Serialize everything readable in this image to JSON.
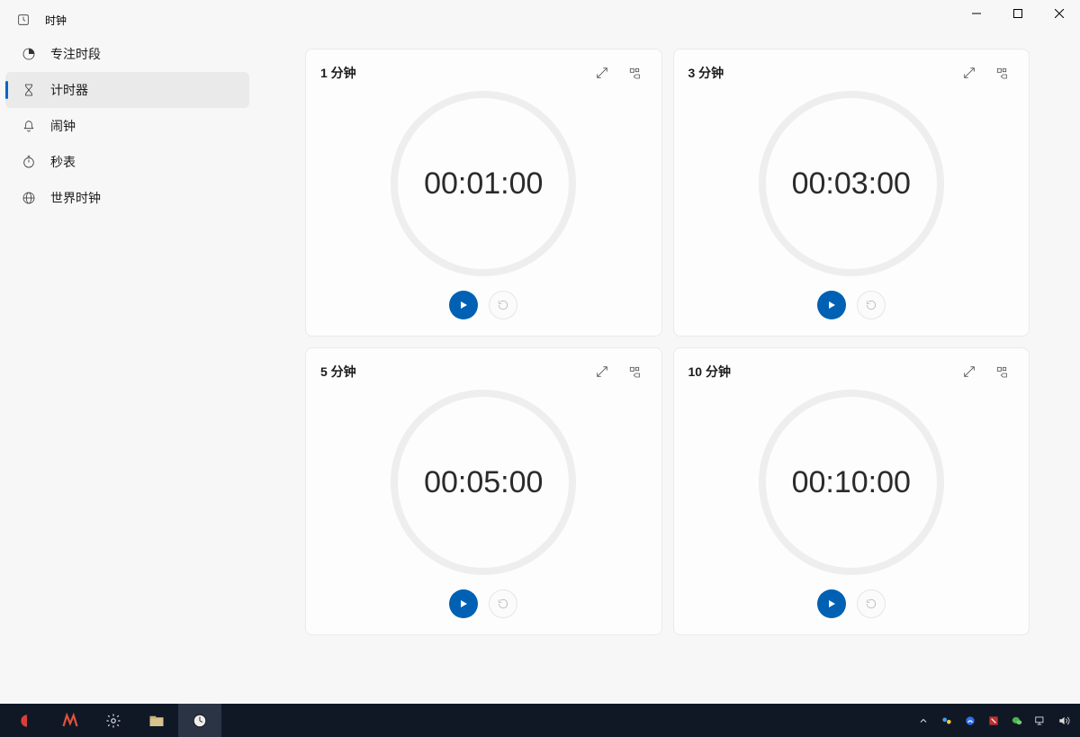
{
  "app_title": "时钟",
  "sidebar": {
    "items": [
      {
        "label": "专注时段"
      },
      {
        "label": "计时器"
      },
      {
        "label": "闹钟"
      },
      {
        "label": "秒表"
      },
      {
        "label": "世界时钟"
      }
    ],
    "active_index": 1
  },
  "timers": [
    {
      "title": "1 分钟",
      "display": "00:01:00"
    },
    {
      "title": "3 分钟",
      "display": "00:03:00"
    },
    {
      "title": "5 分钟",
      "display": "00:05:00"
    },
    {
      "title": "10 分钟",
      "display": "00:10:00"
    }
  ],
  "colors": {
    "accent": "#0067c0"
  }
}
